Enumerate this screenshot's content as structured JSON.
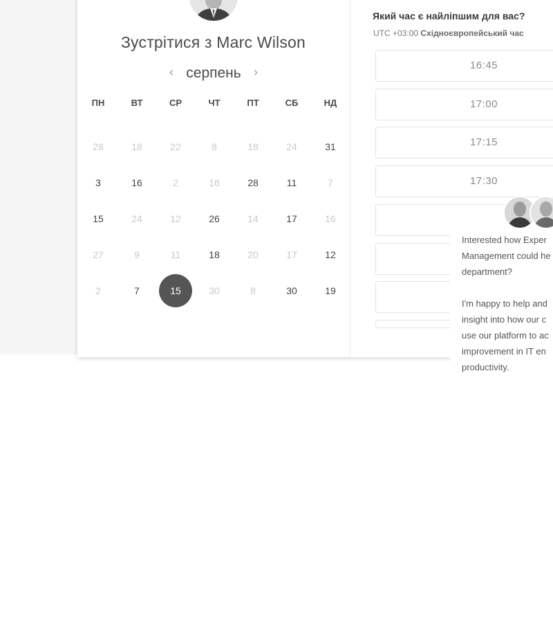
{
  "meet": {
    "title": "Зустрітися з Marc Wilson"
  },
  "calendar": {
    "month": "серпень",
    "prev_icon": "‹",
    "next_icon": "›",
    "weekdays": [
      "ПН",
      "ВТ",
      "СР",
      "ЧТ",
      "ПТ",
      "СБ",
      "НД"
    ],
    "weeks": [
      [
        {
          "d": "28",
          "s": "unavail"
        },
        {
          "d": "18",
          "s": "unavail"
        },
        {
          "d": "22",
          "s": "unavail"
        },
        {
          "d": "8",
          "s": "unavail"
        },
        {
          "d": "18",
          "s": "unavail"
        },
        {
          "d": "24",
          "s": "unavail"
        },
        {
          "d": "31",
          "s": "avail"
        }
      ],
      [
        {
          "d": "3",
          "s": "avail"
        },
        {
          "d": "16",
          "s": "avail"
        },
        {
          "d": "2",
          "s": "unavail"
        },
        {
          "d": "16",
          "s": "unavail"
        },
        {
          "d": "28",
          "s": "avail"
        },
        {
          "d": "11",
          "s": "avail"
        },
        {
          "d": "7",
          "s": "unavail"
        }
      ],
      [
        {
          "d": "15",
          "s": "avail"
        },
        {
          "d": "24",
          "s": "unavail"
        },
        {
          "d": "12",
          "s": "unavail"
        },
        {
          "d": "26",
          "s": "avail"
        },
        {
          "d": "14",
          "s": "unavail"
        },
        {
          "d": "17",
          "s": "avail"
        },
        {
          "d": "16",
          "s": "unavail"
        }
      ],
      [
        {
          "d": "27",
          "s": "unavail"
        },
        {
          "d": "9",
          "s": "unavail"
        },
        {
          "d": "11",
          "s": "unavail"
        },
        {
          "d": "18",
          "s": "avail"
        },
        {
          "d": "20",
          "s": "unavail"
        },
        {
          "d": "17",
          "s": "unavail"
        },
        {
          "d": "12",
          "s": "avail"
        }
      ],
      [
        {
          "d": "2",
          "s": "unavail"
        },
        {
          "d": "7",
          "s": "avail"
        },
        {
          "d": "15",
          "s": "selected"
        },
        {
          "d": "30",
          "s": "unavail"
        },
        {
          "d": "8",
          "s": "unavail"
        },
        {
          "d": "30",
          "s": "avail"
        },
        {
          "d": "19",
          "s": "avail"
        }
      ]
    ]
  },
  "times": {
    "question": "Який час є найліпшим для вас?",
    "tz_offset": "UTC +03:00",
    "tz_name": "Східноєвропейський час",
    "slots": [
      "16:45",
      "17:00",
      "17:15",
      "17:30",
      "",
      "",
      "",
      ""
    ]
  },
  "chat": {
    "lines": [
      "Interested how Exper",
      "Management could he",
      "department?",
      "",
      "I'm happy to help and",
      "insight into how our c",
      "use our platform to ac",
      "improvement in IT en",
      "productivity."
    ]
  },
  "colors": {
    "selected_day": "#555555",
    "background_band": "#f5f5f5"
  }
}
